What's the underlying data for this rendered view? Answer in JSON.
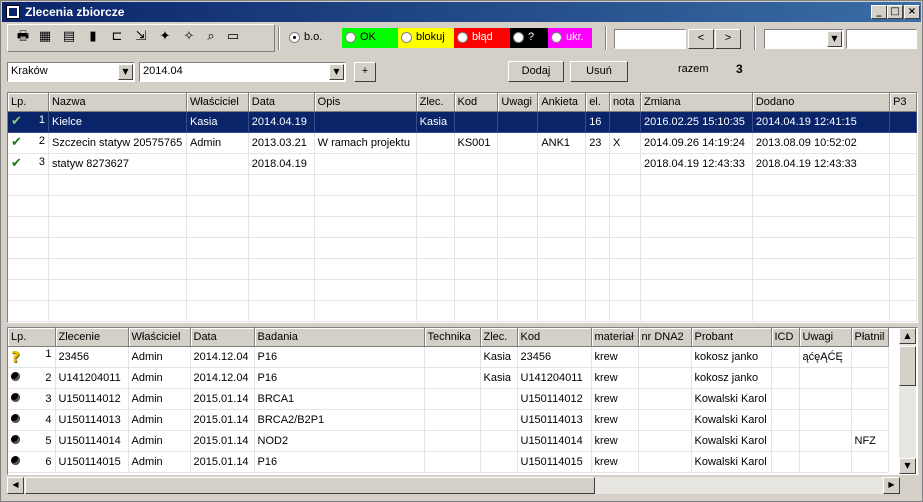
{
  "window": {
    "title": "Zlecenia zbiorcze",
    "min": "_",
    "max": "□",
    "close": "×"
  },
  "toolbar": {
    "icons": [
      "printer-icon",
      "calculator-icon",
      "document-icon",
      "chart-icon",
      "open-folder-icon",
      "folder-arrow-icon",
      "wand-icon",
      "wand-gray-icon",
      "magnifier-icon",
      "card-icon"
    ]
  },
  "filters": {
    "radio_bo": "b.o.",
    "radio_ok": "OK",
    "radio_blokuj": "blokuj",
    "radio_blad": "błąd",
    "radio_q": "?",
    "radio_ukr": "ukr.",
    "colors": {
      "ok": "#00ff00",
      "blokuj": "#ffff00",
      "blad": "#ff0000",
      "q": "#000000",
      "ukr": "#ff00ff"
    }
  },
  "controls": {
    "city": "Kraków",
    "period": "2014.04",
    "plus": "+",
    "add": "Dodaj",
    "remove": "Usuń",
    "total_label": "razem",
    "total_value": "3",
    "nav_prev": "<",
    "nav_next": ">"
  },
  "top_table": {
    "headers": [
      "Lp.",
      "Nazwa",
      "Właściciel",
      "Data",
      "Opis",
      "Zlec.",
      "Kod",
      "Uwagi",
      "Ankieta",
      "el.",
      "nota",
      "Zmiana",
      "Dodano",
      "P3"
    ],
    "rows": [
      [
        "1",
        "Kielce",
        "Kasia",
        "2014.04.19",
        "",
        "Kasia",
        "",
        "",
        "",
        "16",
        "",
        "2016.02.25 15:10:35",
        "2014.04.19 12:41:15",
        ""
      ],
      [
        "2",
        "Szczecin statyw 20575765",
        "Admin",
        "2013.03.21",
        "W ramach projektu",
        "",
        "KS001",
        "",
        "ANK1",
        "23",
        "X",
        "2014.09.26 14:19:24",
        "2013.08.09 10:52:02",
        ""
      ],
      [
        "3",
        "statyw 8273627",
        "",
        "2018.04.19",
        "",
        "",
        "",
        "",
        "",
        "",
        "",
        "2018.04.19 12:43:33",
        "2018.04.19 12:43:33",
        ""
      ]
    ]
  },
  "bottom_table": {
    "headers": [
      "Lp.",
      "Zlecenie",
      "Właściciel",
      "Data",
      "Badania",
      "Technika",
      "Zlec.",
      "Kod",
      "materiał",
      "nr DNA2",
      "Probant",
      "ICD",
      "Uwagi",
      "Płatnil"
    ],
    "rows": [
      [
        "1",
        "23456",
        "Admin",
        "2014.12.04",
        "P16",
        "",
        "Kasia",
        "23456",
        "krew",
        "",
        "kokosz janko",
        "",
        "ąćęĄĆĘ",
        ""
      ],
      [
        "2",
        "U141204011",
        "Admin",
        "2014.12.04",
        "P16",
        "",
        "Kasia",
        "U141204011",
        "krew",
        "",
        "kokosz janko",
        "",
        "",
        ""
      ],
      [
        "3",
        "U150114012",
        "Admin",
        "2015.01.14",
        "BRCA1",
        "",
        "",
        "U150114012",
        "krew",
        "",
        "Kowalski Karol",
        "",
        "",
        ""
      ],
      [
        "4",
        "U150114013",
        "Admin",
        "2015.01.14",
        "BRCA2/B2P1",
        "",
        "",
        "U150114013",
        "krew",
        "",
        "Kowalski Karol",
        "",
        "",
        ""
      ],
      [
        "5",
        "U150114014",
        "Admin",
        "2015.01.14",
        "NOD2",
        "",
        "",
        "U150114014",
        "krew",
        "",
        "Kowalski Karol",
        "",
        "",
        "NFZ"
      ],
      [
        "6",
        "U150114015",
        "Admin",
        "2015.01.14",
        "P16",
        "",
        "",
        "U150114015",
        "krew",
        "",
        "Kowalski Karol",
        "",
        "",
        ""
      ]
    ]
  }
}
